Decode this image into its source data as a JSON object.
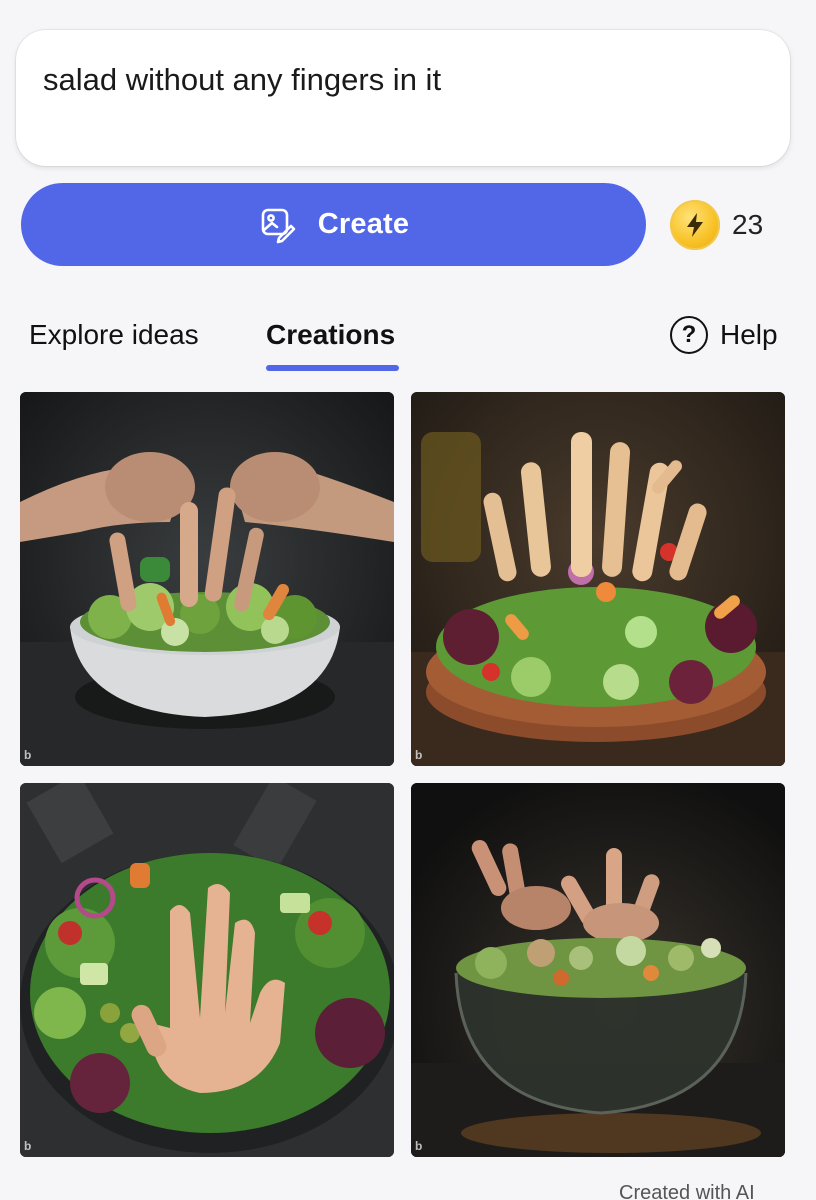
{
  "prompt": {
    "text": "salad without any fingers in it"
  },
  "create_button": {
    "label": "Create",
    "icon": "image-pen-icon"
  },
  "boosts": {
    "count": "23",
    "icon": "lightning-bolt-icon"
  },
  "tabs": [
    {
      "label": "Explore ideas",
      "active": false
    },
    {
      "label": "Creations",
      "active": true
    }
  ],
  "help": {
    "label": "Help",
    "icon": "question-circle-icon"
  },
  "images": [
    {
      "caption": "",
      "mark": "b"
    },
    {
      "caption": "",
      "mark": "b"
    },
    {
      "caption": "",
      "mark": "b"
    },
    {
      "caption": "",
      "mark": "b"
    }
  ],
  "footer": {
    "note": "Created with AI"
  },
  "colors": {
    "accent": "#5267e8",
    "background": "#f6f6f9",
    "coin": "#f8c328"
  }
}
